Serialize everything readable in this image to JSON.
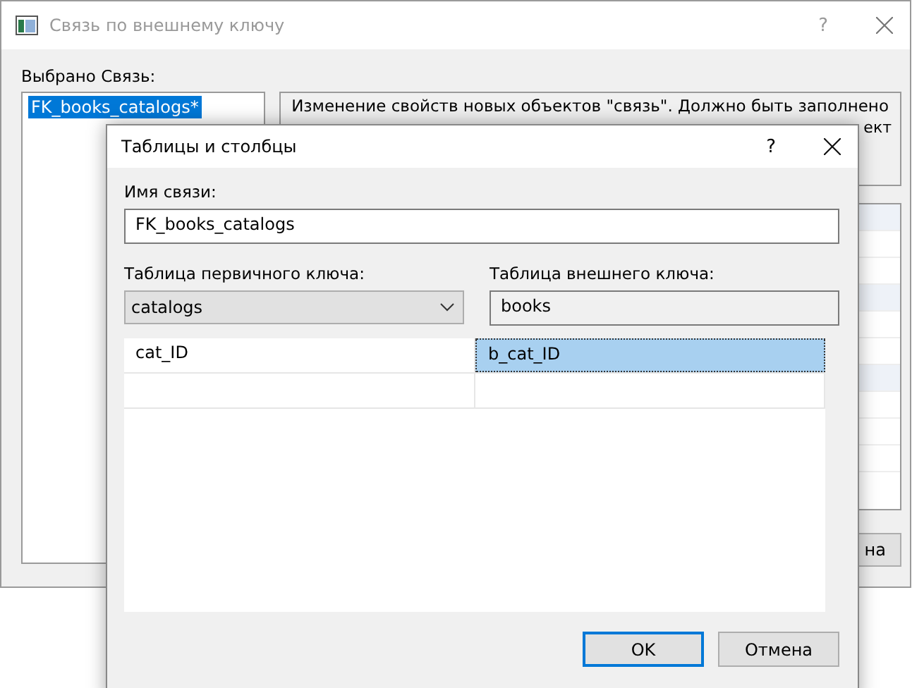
{
  "back_window": {
    "title": "Связь по внешнему ключу",
    "help": "?",
    "selected_label": "Выбрано Связь:",
    "relations": [
      {
        "label": "FK_books_catalogs*",
        "selected": true
      }
    ],
    "description": "Изменение свойств новых объектов \"связь\".  Должно быть заполнено",
    "description_tail": "ект",
    "button_partial": "на"
  },
  "dialog": {
    "title": "Таблицы и столбцы",
    "help": "?",
    "name_label": "Имя связи:",
    "name_value": "FK_books_catalogs",
    "primary_label": "Таблица первичного ключа:",
    "primary_value": "catalogs",
    "foreign_label": "Таблица внешнего ключа:",
    "foreign_value": "books",
    "rows": [
      {
        "cells": [
          {
            "text": "cat_ID",
            "selected": false
          },
          {
            "text": "b_cat_ID",
            "selected": true
          }
        ]
      },
      {
        "cells": [
          {
            "text": "",
            "selected": false
          },
          {
            "text": "",
            "selected": false
          }
        ]
      }
    ],
    "buttons": [
      {
        "label": "OK",
        "kind": "default"
      },
      {
        "label": "Отмена",
        "kind": "normal"
      }
    ]
  }
}
